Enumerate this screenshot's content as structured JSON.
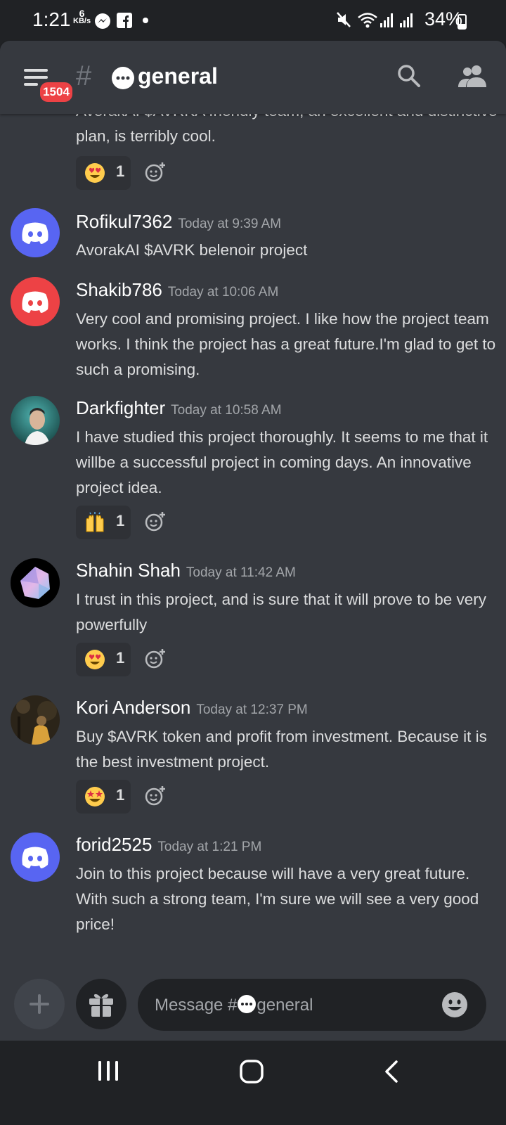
{
  "status_bar": {
    "time": "1:21",
    "net_speed_value": "6",
    "net_speed_unit": "KB/s",
    "battery": "34%"
  },
  "header": {
    "menu_badge": "1504",
    "channel_name": "general",
    "icons": [
      "menu-icon",
      "hash-icon",
      "search-icon",
      "members-icon"
    ]
  },
  "messages": [
    {
      "text": "AvorakAI $AVRKA friendly team, an excellent and distinctive plan, is terribly cool.",
      "reaction": {
        "emoji": "heart-eyes-emoji",
        "count": "1"
      }
    },
    {
      "author": "Rofikul7362",
      "timestamp": "Today at 9:39 AM",
      "text": "AvorakAI $AVRK belenoir project",
      "avatar_color": "#5865f2"
    },
    {
      "author": "Shakib786",
      "timestamp": "Today at 10:06 AM",
      "text": "Very cool and promising project. I like how the project team works. I think the project has a great future.I'm glad to get to such a promising.",
      "avatar_color": "#ed4245"
    },
    {
      "author": "Darkfighter",
      "timestamp": "Today at 10:58 AM",
      "text": "I have studied this project thoroughly. It seems to me that it willbe a successful project in coming days. An innovative project idea.",
      "reaction": {
        "emoji": "raising-hands-emoji",
        "count": "1"
      }
    },
    {
      "author": "Shahin Shah",
      "timestamp": "Today at 11:42 AM",
      "text": "I trust in this project, and is sure that it will prove to be very powerfully",
      "reaction": {
        "emoji": "heart-eyes-emoji",
        "count": "1"
      }
    },
    {
      "author": "Kori Anderson",
      "timestamp": "Today at 12:37 PM",
      "text": "Buy $AVRK token and profit from investment. Because it is the best investment project.",
      "reaction": {
        "emoji": "star-struck-emoji",
        "count": "1"
      }
    },
    {
      "author": "forid2525",
      "timestamp": "Today at 1:21 PM",
      "text": "Join to this project because will have a very great future. With such a strong team, I'm sure we will see a very good price!",
      "avatar_color": "#5865f2"
    }
  ],
  "input": {
    "placeholder_prefix": "Message #",
    "placeholder_channel": "general"
  },
  "colors": {
    "background": "#36393f",
    "dark": "#202225",
    "blurple": "#5865f2",
    "red": "#ed4245"
  }
}
